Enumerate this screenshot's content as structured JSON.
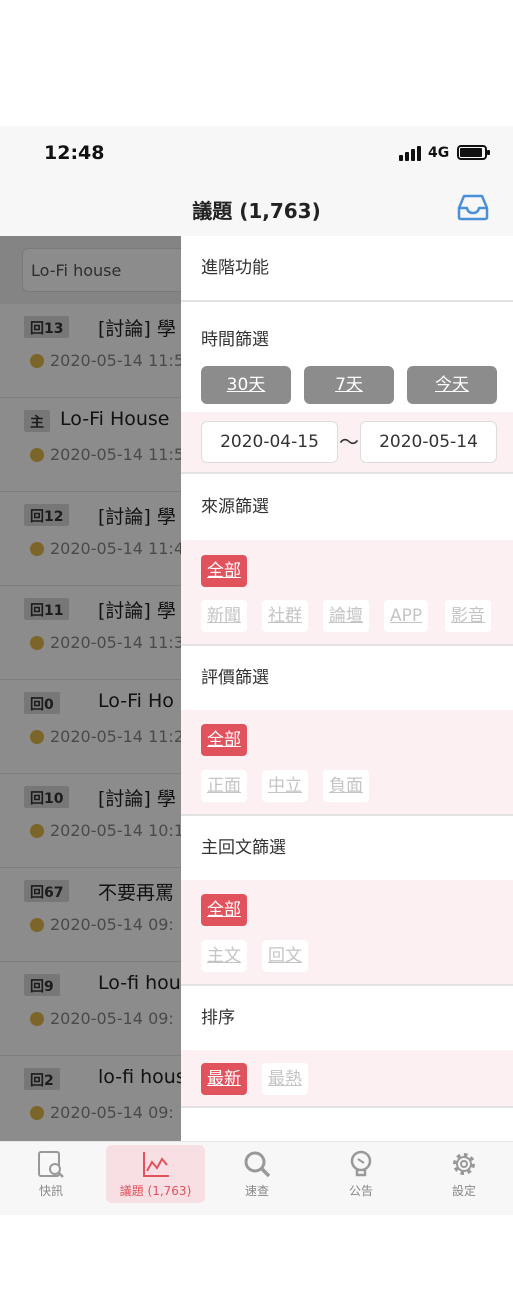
{
  "status_bar": {
    "time": "12:48",
    "network": "4G"
  },
  "nav": {
    "title": "議題 (1,763)"
  },
  "search": {
    "value": "Lo-Fi house"
  },
  "list_items": [
    {
      "badge": "回13",
      "title": "[討論] 學",
      "date": "2020-05-14 11:5"
    },
    {
      "badge": "主",
      "title": "Lo-Fi House",
      "date": "2020-05-14 11:5"
    },
    {
      "badge": "回12",
      "title": "[討論] 學",
      "date": "2020-05-14 11:4"
    },
    {
      "badge": "回11",
      "title": "[討論] 學",
      "date": "2020-05-14 11:3"
    },
    {
      "badge": "回0",
      "title": "Lo-Fi Ho",
      "date": "2020-05-14 11:2"
    },
    {
      "badge": "回10",
      "title": "[討論] 學",
      "date": "2020-05-14 10:1"
    },
    {
      "badge": "回67",
      "title": "不要再罵",
      "date": "2020-05-14 09:"
    },
    {
      "badge": "回9",
      "title": "Lo-fi hou",
      "date": "2020-05-14 09:"
    },
    {
      "badge": "回2",
      "title": "lo-fi hous",
      "date": "2020-05-14 09:"
    }
  ],
  "drawer": {
    "advanced_label": "進階功能",
    "time_filter": {
      "label": "時間篩選",
      "ranges": [
        "30天",
        "7天",
        "今天"
      ],
      "start_date": "2020-04-15",
      "separator": "～",
      "end_date": "2020-05-14"
    },
    "source_filter": {
      "label": "來源篩選",
      "all": "全部",
      "options": [
        "新聞",
        "社群",
        "論壇",
        "APP",
        "影音"
      ]
    },
    "rating_filter": {
      "label": "評價篩選",
      "all": "全部",
      "options": [
        "正面",
        "中立",
        "負面"
      ]
    },
    "post_filter": {
      "label": "主回文篩選",
      "all": "全部",
      "options": [
        "主文",
        "回文"
      ]
    },
    "sort": {
      "label": "排序",
      "options": [
        "最新",
        "最熱"
      ]
    }
  },
  "tabs": [
    {
      "label": "快訊",
      "icon": "news-search-icon"
    },
    {
      "label": "議題 (1,763)",
      "icon": "chart-line-icon"
    },
    {
      "label": "速查",
      "icon": "magnifier-icon"
    },
    {
      "label": "公告",
      "icon": "announcement-icon"
    },
    {
      "label": "設定",
      "icon": "gear-icon"
    }
  ],
  "colors": {
    "accent": "#e0525c",
    "brand_blue": "#4a90d9",
    "pink_bg": "#fdf0f2",
    "dot": "#e0b84a"
  }
}
